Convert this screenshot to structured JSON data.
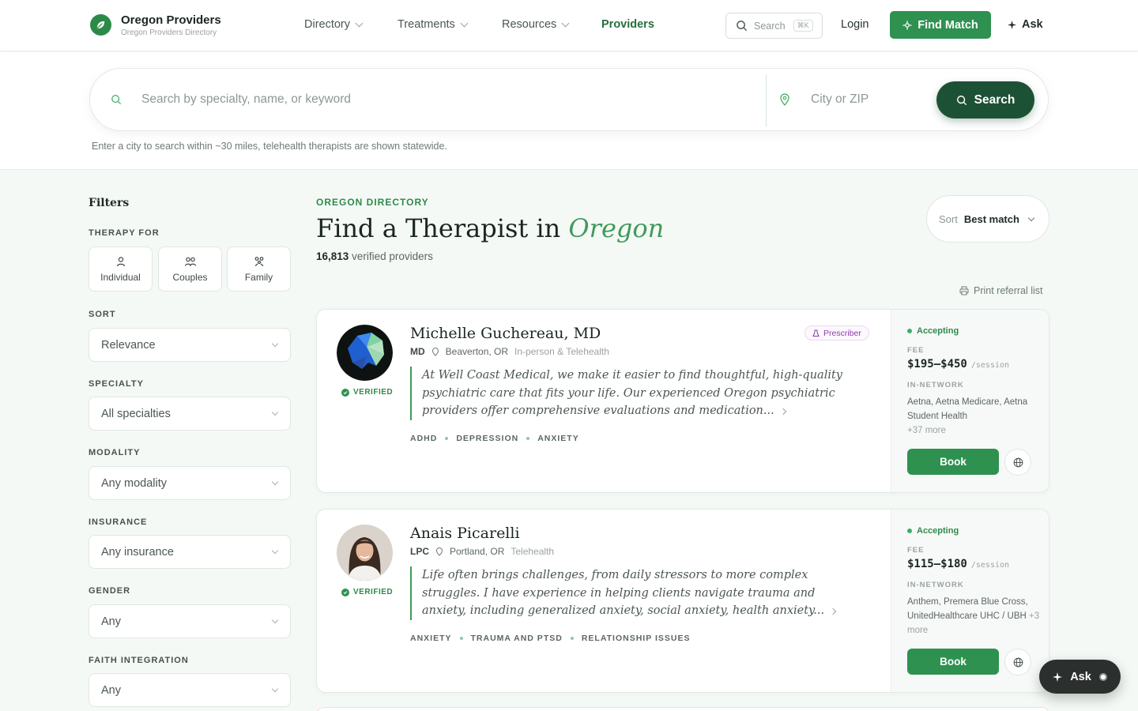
{
  "header": {
    "brand_title": "Oregon Providers",
    "brand_subtitle": "Oregon Providers Directory",
    "nav": [
      {
        "label": "Directory"
      },
      {
        "label": "Treatments"
      },
      {
        "label": "Resources"
      },
      {
        "label": "Providers"
      }
    ],
    "search_label": "Search",
    "search_shortcut": "⌘K",
    "login_label": "Login",
    "find_match_label": "Find Match",
    "ask_label": "Ask"
  },
  "search": {
    "query_placeholder": "Search by specialty, name, or keyword",
    "location_placeholder": "City or ZIP",
    "button_label": "Search",
    "hint": "Enter a city to search within ~30 miles, telehealth therapists are shown statewide."
  },
  "filters": {
    "title": "Filters",
    "therapy_for_label": "THERAPY FOR",
    "therapy_for": [
      {
        "label": "Individual",
        "icon": "person-icon"
      },
      {
        "label": "Couples",
        "icon": "couple-icon"
      },
      {
        "label": "Family",
        "icon": "family-icon"
      }
    ],
    "sort_label": "SORT",
    "sort_value": "Relevance",
    "specialty_label": "SPECIALTY",
    "specialty_value": "All specialties",
    "modality_label": "MODALITY",
    "modality_value": "Any modality",
    "insurance_label": "INSURANCE",
    "insurance_value": "Any insurance",
    "gender_label": "GENDER",
    "gender_value": "Any",
    "faith_label": "FAITH INTEGRATION",
    "faith_value": "Any"
  },
  "main": {
    "eyebrow": "OREGON DIRECTORY",
    "title_prefix": "Find a Therapist in",
    "title_accent": "Oregon",
    "count": "16,813",
    "count_suffix": "verified providers",
    "sort_label": "Sort",
    "sort_value": "Best match",
    "print_label": "Print referral list"
  },
  "providers": [
    {
      "name": "Michelle Guchereau, MD",
      "credential": "MD",
      "location": "Beaverton, OR",
      "mode": "In-person & Telehealth",
      "verified": "VERIFIED",
      "badge": "Prescriber",
      "quote": "At Well Coast Medical, we make it easier to find thoughtful, high-quality psychiatric care that fits your life. Our experienced Oregon psychiatric providers offer comprehensive evaluations and medication...",
      "tags": [
        "ADHD",
        "DEPRESSION",
        "ANXIETY"
      ],
      "status": "Accepting",
      "fee_label": "FEE",
      "fee": "$195–$450",
      "fee_unit": "/session",
      "network_label": "IN-NETWORK",
      "insurance": "Aetna, Aetna Medicare, Aetna Student Health",
      "insurance_more": "+37 more",
      "book_label": "Book"
    },
    {
      "name": "Anais Picarelli",
      "credential": "LPC",
      "location": "Portland, OR",
      "mode": "Telehealth",
      "verified": "VERIFIED",
      "quote": "Life often brings challenges, from daily stressors to more complex struggles. I have experience in helping clients navigate trauma and anxiety, including generalized anxiety, social anxiety, health anxiety...",
      "tags": [
        "ANXIETY",
        "TRAUMA AND PTSD",
        "RELATIONSHIP ISSUES"
      ],
      "status": "Accepting",
      "fee_label": "FEE",
      "fee": "$115–$180",
      "fee_unit": "/session",
      "network_label": "IN-NETWORK",
      "insurance": "Anthem, Premera Blue Cross, UnitedHealthcare UHC / UBH",
      "insurance_more": "+3 more",
      "book_label": "Book"
    }
  ],
  "float_ask_label": "Ask",
  "colors": {
    "brand": "#2e9150",
    "dark": "#1d5135",
    "accent_text": "#3f9a5a"
  }
}
